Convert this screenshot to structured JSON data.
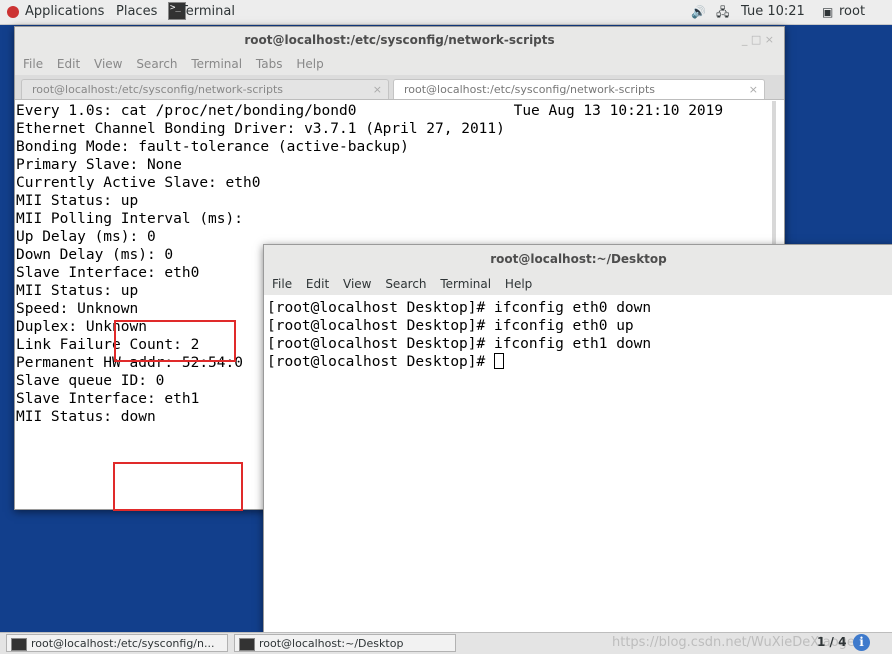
{
  "topbar": {
    "applications": "Applications",
    "places": "Places",
    "terminal_app": "Terminal",
    "clock": "Tue 10:21",
    "user": "root",
    "volume_icon": "volume-icon",
    "network_icon": "network-icon"
  },
  "window1": {
    "title": "root@localhost:/etc/sysconfig/network-scripts",
    "controls": "_   □   ×",
    "menu": [
      "File",
      "Edit",
      "View",
      "Search",
      "Terminal",
      "Tabs",
      "Help"
    ],
    "tabs": [
      {
        "label": "root@localhost:/etc/sysconfig/network-scripts",
        "close": "×"
      },
      {
        "label": "root@localhost:/etc/sysconfig/network-scripts",
        "close": "×"
      }
    ],
    "lines": [
      "Every 1.0s: cat /proc/net/bonding/bond0                  Tue Aug 13 10:21:10 2019",
      "",
      "Ethernet Channel Bonding Driver: v3.7.1 (April 27, 2011)",
      "",
      "Bonding Mode: fault-tolerance (active-backup)",
      "Primary Slave: None",
      "Currently Active Slave: eth0",
      "MII Status: up",
      "MII Polling Interval (ms):",
      "Up Delay (ms): 0",
      "Down Delay (ms): 0",
      "",
      "Slave Interface: eth0",
      "MII Status: up",
      "Speed: Unknown",
      "Duplex: Unknown",
      "Link Failure Count: 2",
      "Permanent HW addr: 52:54:0",
      "Slave queue ID: 0",
      "",
      "Slave Interface: eth1",
      "MII Status: down"
    ]
  },
  "window2": {
    "title": "root@localhost:~/Desktop",
    "menu": [
      "File",
      "Edit",
      "View",
      "Search",
      "Terminal",
      "Help"
    ],
    "lines": [
      "[root@localhost Desktop]# ifconfig eth0 down",
      "[root@localhost Desktop]# ifconfig eth0 up",
      "[root@localhost Desktop]# ifconfig eth1 down"
    ],
    "prompt": "[root@localhost Desktop]# "
  },
  "taskbar": {
    "tasks": [
      "root@localhost:/etc/sysconfig/n...",
      "root@localhost:~/Desktop"
    ],
    "watermark": "https://blog.csdn.net/WuXieDeXiaoge",
    "pager": "1 / 4",
    "info_icon": "i"
  }
}
